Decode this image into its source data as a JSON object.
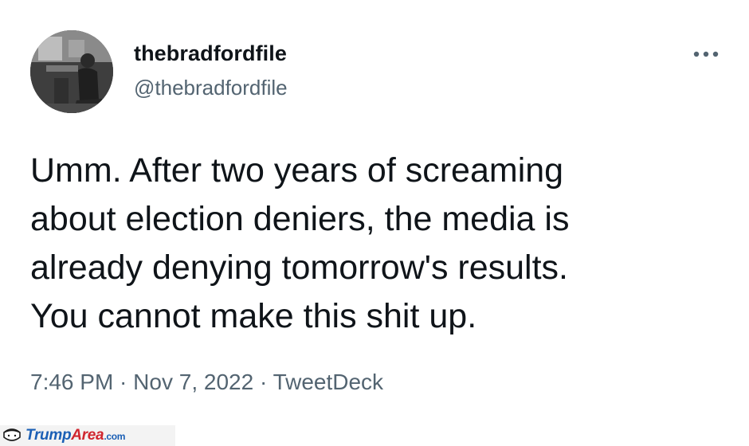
{
  "tweet": {
    "display_name": "thebradfordfile",
    "handle": "@thebradfordfile",
    "avatar_icon": "profile-photo",
    "more_icon": "more-horizontal-icon",
    "text": "Umm. After two years of screaming\nabout election deniers, the media is\nalready denying tomorrow's results.\nYou cannot make this shit up.",
    "time": "7:46 PM",
    "separator": " · ",
    "date": "Nov 7, 2022",
    "source": "TweetDeck"
  },
  "watermark": {
    "brand_part1": "Trump",
    "brand_part2": "Area",
    "brand_suffix": ".com",
    "colors": {
      "trump": "#1b5fb5",
      "area": "#d0262f"
    }
  },
  "colors": {
    "text_primary": "#0f1419",
    "text_secondary": "#536471",
    "background": "#ffffff"
  }
}
